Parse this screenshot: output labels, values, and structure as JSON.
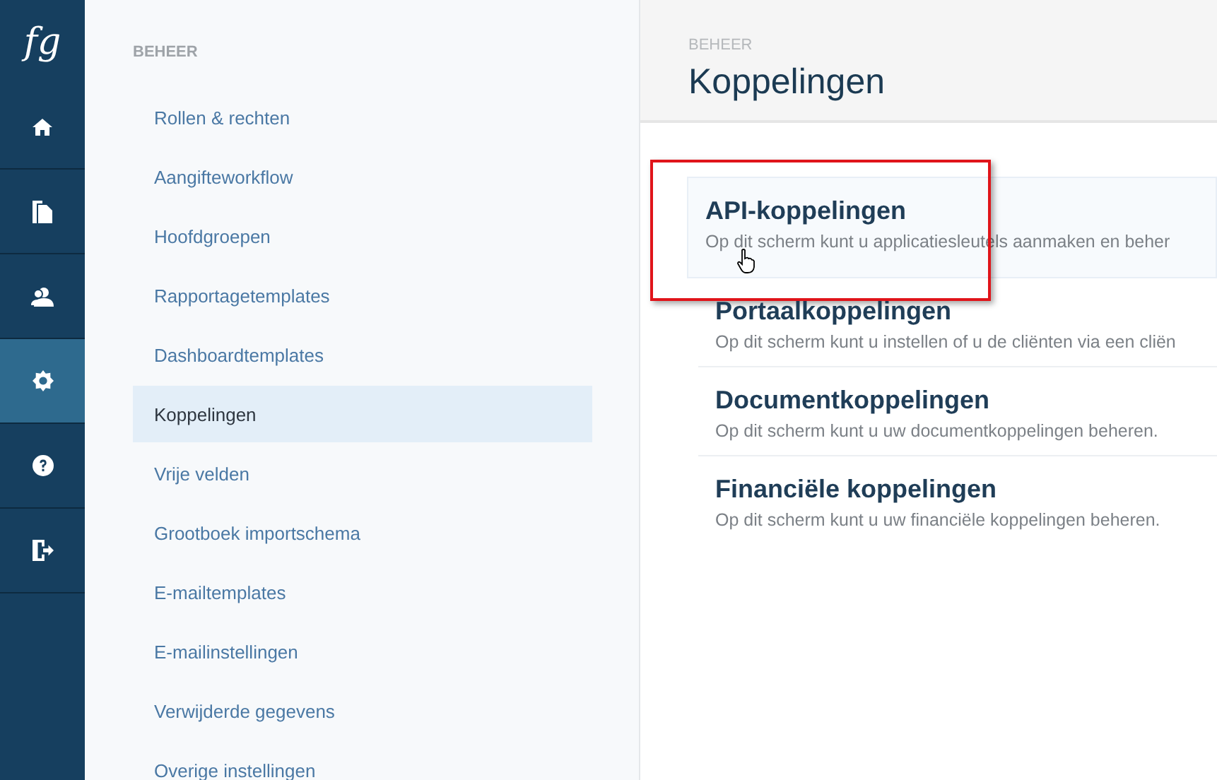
{
  "logo": "fg",
  "rail": [
    {
      "selected": false
    },
    {
      "selected": false
    },
    {
      "selected": false
    },
    {
      "selected": true
    },
    {
      "selected": false
    },
    {
      "selected": false
    }
  ],
  "sidebar": {
    "heading": "BEHEER",
    "items": [
      {
        "label": "Rollen & rechten",
        "selected": false
      },
      {
        "label": "Aangifteworkflow",
        "selected": false
      },
      {
        "label": "Hoofdgroepen",
        "selected": false
      },
      {
        "label": "Rapportagetemplates",
        "selected": false
      },
      {
        "label": "Dashboardtemplates",
        "selected": false
      },
      {
        "label": "Koppelingen",
        "selected": true
      },
      {
        "label": "Vrije velden",
        "selected": false
      },
      {
        "label": "Grootboek importschema",
        "selected": false
      },
      {
        "label": "E-mailtemplates",
        "selected": false
      },
      {
        "label": "E-mailinstellingen",
        "selected": false
      },
      {
        "label": "Verwijderde gegevens",
        "selected": false
      },
      {
        "label": "Overige instellingen",
        "selected": false
      }
    ]
  },
  "header": {
    "breadcrumb": "BEHEER",
    "title": "Koppelingen"
  },
  "links": [
    {
      "title": "API-koppelingen",
      "description": "Op dit scherm kunt u applicatiesleutels aanmaken en beher",
      "hovered": true,
      "highlighted": true
    },
    {
      "title": "Portaalkoppelingen",
      "description": "Op dit scherm kunt u instellen of u de cliënten via een cliën",
      "hovered": false,
      "highlighted": false
    },
    {
      "title": "Documentkoppelingen",
      "description": "Op dit scherm kunt u uw documentkoppelingen beheren.",
      "hovered": false,
      "highlighted": false
    },
    {
      "title": "Financiële koppelingen",
      "description": "Op dit scherm kunt u uw financiële koppelingen beheren.",
      "hovered": false,
      "highlighted": false
    }
  ]
}
